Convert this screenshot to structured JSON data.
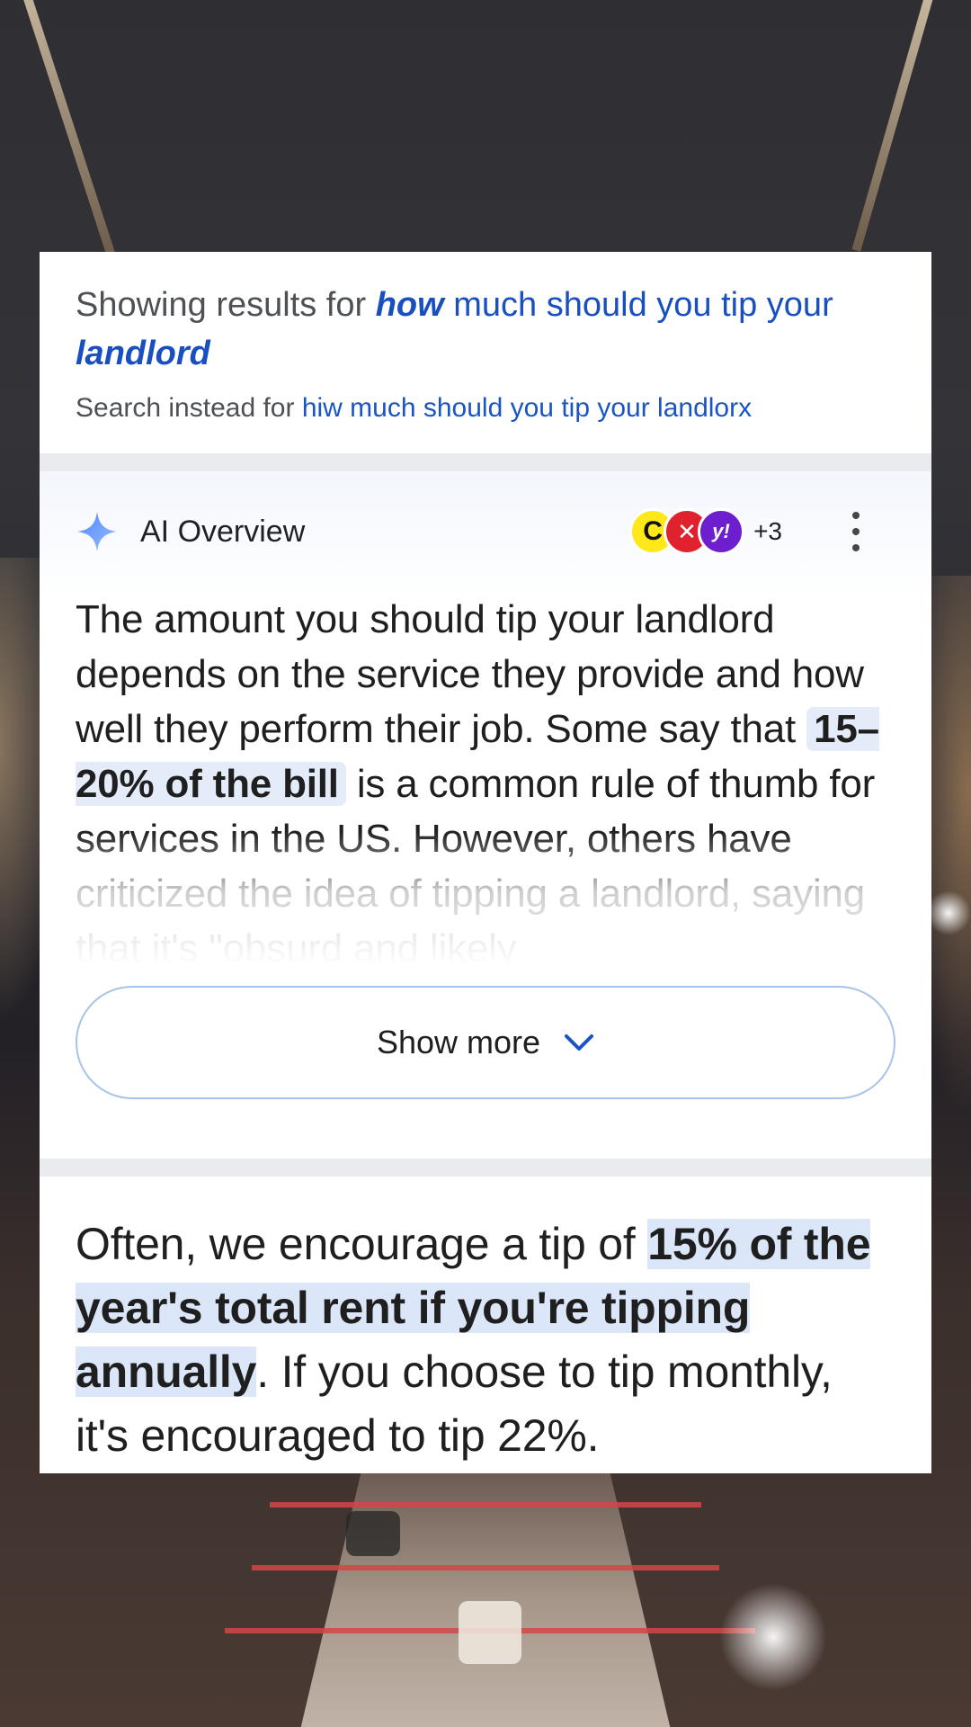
{
  "correction": {
    "prefix": "Showing results for",
    "corrected_bold": "how",
    "corrected_rest": "much should you tip your",
    "corrected_bold_end": "landlord",
    "instead_prefix": "Search instead for",
    "original_query": "hiw much should you tip your landlorx"
  },
  "ai_overview": {
    "title": "AI Overview",
    "sources": [
      {
        "icon": "c-logo-icon",
        "glyph": "C",
        "color": "#ffe81a"
      },
      {
        "icon": "red-logo-icon",
        "glyph": "✕",
        "color": "#e0222e"
      },
      {
        "icon": "yahoo-logo-icon",
        "glyph": "y!",
        "color": "#6d1fd0"
      }
    ],
    "more_sources": "+3",
    "text_before": "The amount you should tip your landlord depends on the service they provide and how well they perform their job. Some say that",
    "highlight": "15–20% of the bill",
    "text_after": "is a common rule of thumb for services in the US. However, others have criticized the idea of tipping a landlord, saying that it's \"obsurd and likely",
    "show_more_label": "Show more"
  },
  "snippet": {
    "text_before": "Often, we encourage a tip of",
    "highlight": "15% of the year's total rent if you're tipping annually",
    "text_after": ". If you choose to tip monthly, it's encouraged to tip 22%."
  },
  "colors": {
    "link": "#1a4fbf",
    "highlight_bg": "#e4ecfa",
    "divider": "#e9ebee",
    "button_border": "#a8c3e8"
  }
}
